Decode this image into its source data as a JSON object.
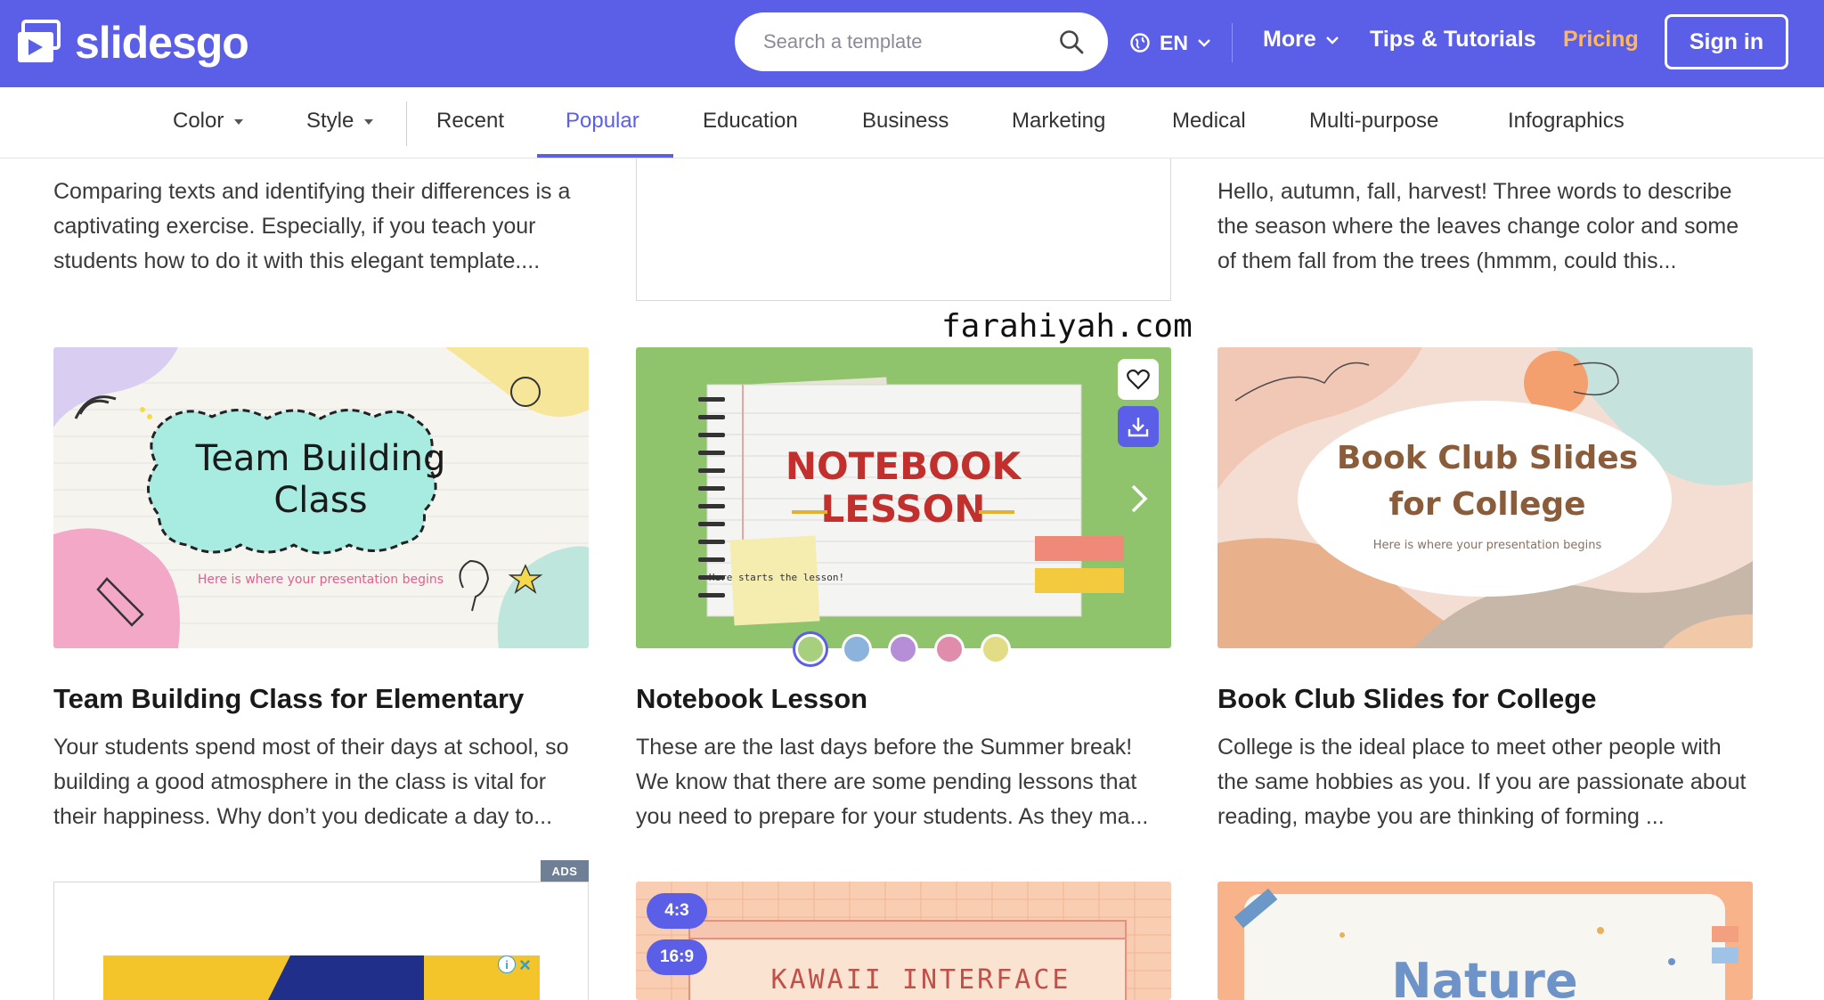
{
  "header": {
    "logo_text": "slidesgo",
    "search_placeholder": "Search a template",
    "lang": "EN",
    "more": "More",
    "tips": "Tips & Tutorials",
    "pricing": "Pricing",
    "signin": "Sign in"
  },
  "filters": {
    "color": "Color",
    "style": "Style",
    "tabs": [
      "Recent",
      "Popular",
      "Education",
      "Business",
      "Marketing",
      "Medical",
      "Multi-purpose",
      "Infographics"
    ],
    "active_tab": "Popular"
  },
  "top_row": {
    "left_desc": "Comparing texts and identifying their differences is a captivating exercise. Especially, if you teach your students how to do it with this elegant template....",
    "right_desc": "Hello, autumn, fall, harvest! Three words to describe the season where the leaves change color and some of them fall from the trees (hmmm, could this..."
  },
  "watermark": "farahiyah.com",
  "cards": [
    {
      "title": "Team Building Class for Elementary",
      "desc": "Your students spend most of their days at school, so building a good atmosphere in the class is vital for their happiness. Why don’t you dedicate a day to...",
      "thumb_title_line1": "Team Building",
      "thumb_title_line2": "Class",
      "thumb_subtitle": "Here is where your presentation begins"
    },
    {
      "title": "Notebook Lesson",
      "desc": "These are the last days before the Summer break! We know that there are some pending lessons that you need to prepare for your students. As they ma...",
      "thumb_title_line1": "NOTEBOOK",
      "thumb_title_line2": "LESSON",
      "thumb_note": "Here starts the lesson!",
      "color_options": [
        "#a6cf7e",
        "#8cb3dc",
        "#b48fd8",
        "#e08cab",
        "#e2dc86"
      ]
    },
    {
      "title": "Book Club Slides for College",
      "desc": "College is the ideal place to meet other people with the same hobbies as you. If you are passionate about reading, maybe you are thinking of forming ...",
      "thumb_title_line1": "Book Club Slides",
      "thumb_title_line2": "for College",
      "thumb_subtitle": "Here is where your presentation begins"
    }
  ],
  "bottom_row": {
    "ads_label": "ADS",
    "ratio_43": "4:3",
    "ratio_169": "16:9",
    "kawaii_title": "KAWAII INTERFACE",
    "nature_title": "Nature"
  },
  "colors": {
    "brand": "#5b5fe8",
    "pricing": "#ffb65c"
  }
}
